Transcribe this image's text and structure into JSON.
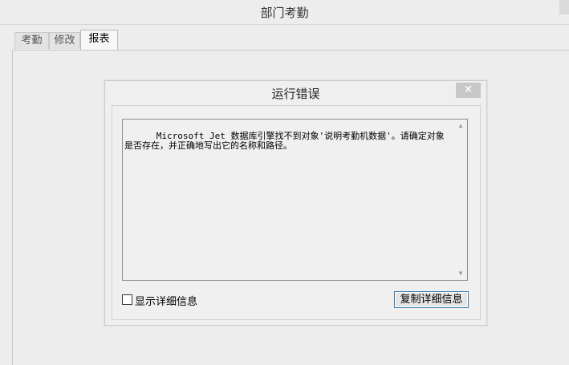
{
  "window": {
    "title": "部门考勤"
  },
  "tabs": [
    {
      "label": "考勤",
      "active": false
    },
    {
      "label": "修改",
      "active": false
    },
    {
      "label": "报表",
      "active": true
    }
  ],
  "dialog": {
    "title": "运行错误",
    "close_symbol": "✕",
    "message": "Microsoft Jet 数据库引擎找不到对象'说明考勤机数据'。请确定对象是否存在，并正确地写出它的名称和路径。",
    "checkbox_label": "显示详细信息",
    "checkbox_checked": false,
    "copy_button_label": "复制详细信息",
    "scroll_up_symbol": "▲",
    "scroll_down_symbol": "▼"
  }
}
